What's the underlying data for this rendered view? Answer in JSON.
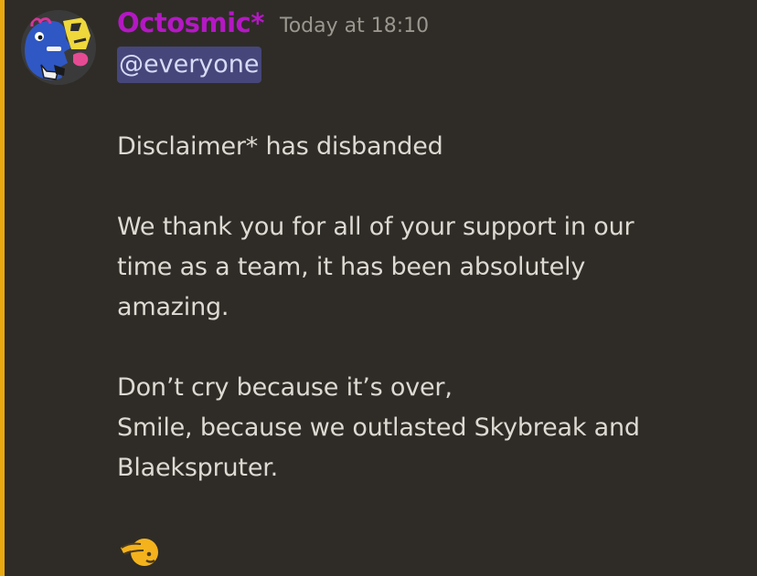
{
  "message": {
    "author": {
      "username": "Octosmic*",
      "avatar_icon": "octopus-mascot-avatar",
      "username_color": "#b418c4"
    },
    "timestamp": "Today at 18:10",
    "mention": "@everyone",
    "paragraphs": [
      {
        "lines": [
          "Disclaimer* has disbanded"
        ]
      },
      {
        "lines": [
          "We thank you for all of your support in our",
          "time as a team, it has been absolutely",
          "amazing."
        ]
      },
      {
        "lines": [
          "Don’t cry because it’s over,",
          "Smile, because we outlasted Skybreak and",
          "Blaekspruter."
        ]
      }
    ],
    "emoji": "saluting-face-icon"
  },
  "colors": {
    "background": "#2f2c27",
    "mention_stripe": "#e9a90f",
    "mention_background": "#46467a",
    "text": "#dddad3",
    "timestamp": "#9a978f"
  }
}
